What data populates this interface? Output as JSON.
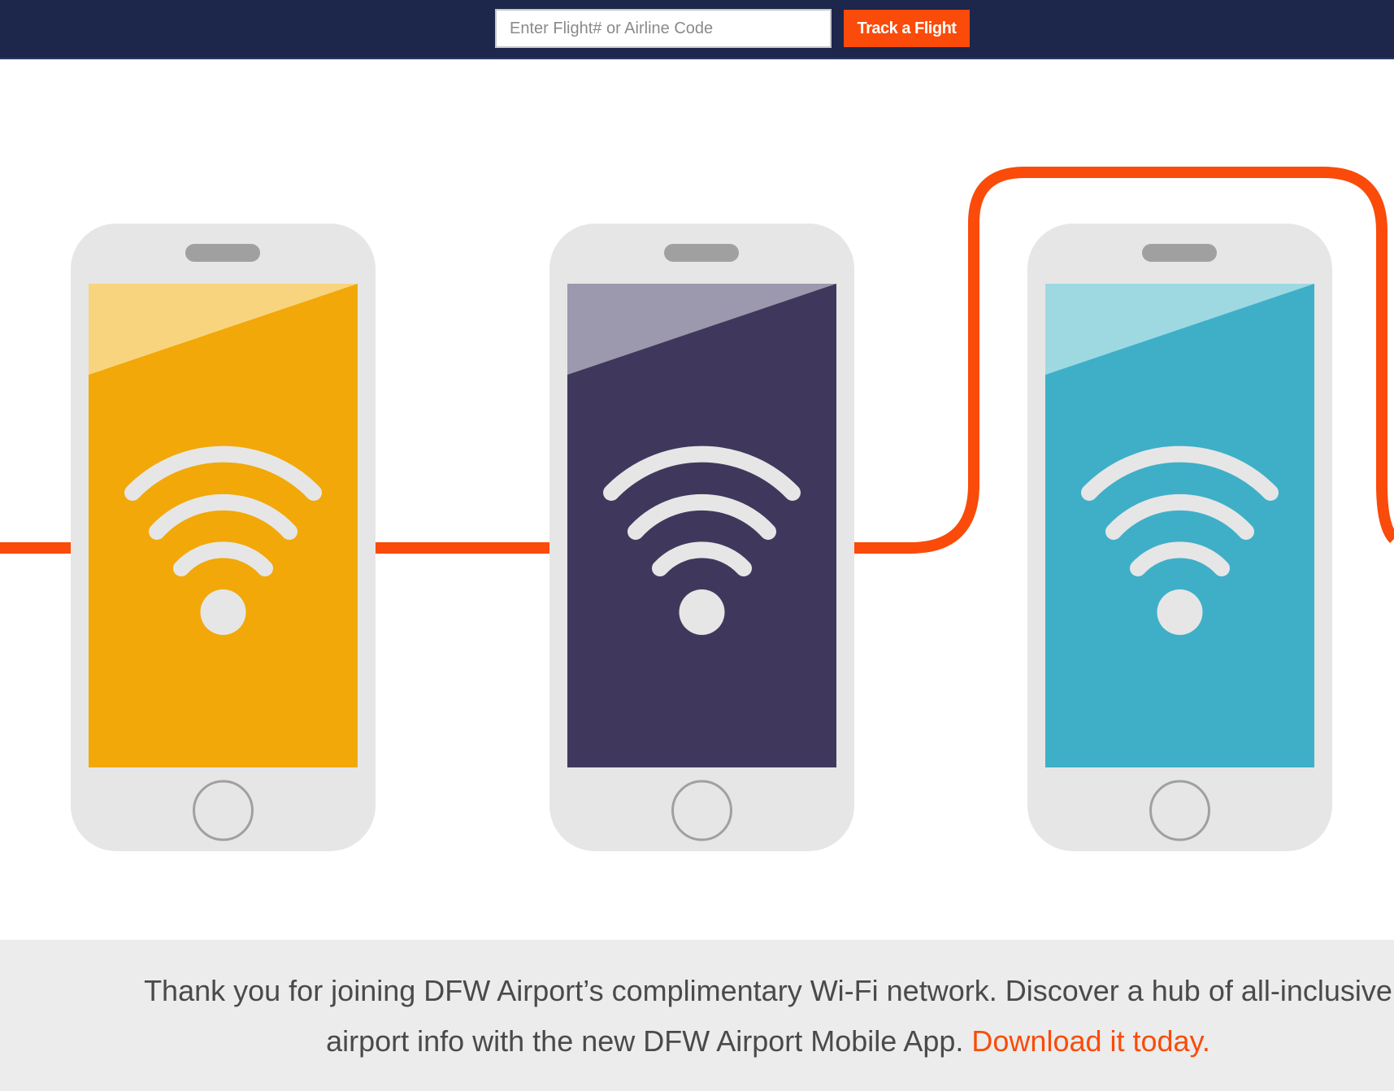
{
  "header": {
    "search": {
      "placeholder": "Enter Flight# or Airline Code",
      "value": ""
    },
    "track_button_label": "Track a Flight"
  },
  "hero": {
    "phones": [
      {
        "name": "phone-yellow",
        "screen_color": "#f2a808",
        "highlight_color": "#f9d47f",
        "icon": "wifi-icon"
      },
      {
        "name": "phone-purple",
        "screen_color": "#40385c",
        "highlight_color": "#9c99ae",
        "icon": "wifi-icon"
      },
      {
        "name": "phone-teal",
        "screen_color": "#3fafc8",
        "highlight_color": "#9ed9e2",
        "icon": "wifi-icon"
      }
    ],
    "line_color": "#fa4b0a"
  },
  "footer": {
    "message_line1": "Thank you for joining DFW Airport’s complimentary Wi-Fi network. Discover a hub of all-inclusive",
    "message_line2": "airport info with the new DFW Airport Mobile App. ",
    "download_link_label": "Download it today."
  },
  "colors": {
    "header_bg": "#1d264b",
    "accent": "#fa4b0a",
    "footer_bg": "#ebeceb",
    "phone_body": "#e6e6e6",
    "phone_detail": "#a0a0a0"
  }
}
